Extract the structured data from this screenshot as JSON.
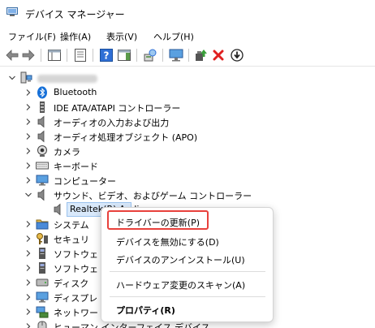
{
  "window": {
    "title": "デバイス マネージャー"
  },
  "menu": {
    "file": "ファイル(F)",
    "action": "操作(A)",
    "view": "表示(V)",
    "help": "ヘルプ(H)"
  },
  "tree": {
    "items": [
      {
        "label": "Bluetooth",
        "icon": "bluetooth-icon"
      },
      {
        "label": "IDE ATA/ATAPI コントローラー",
        "icon": "ide-controller-icon"
      },
      {
        "label": "オーディオの入力および出力",
        "icon": "speaker-icon"
      },
      {
        "label": "オーディオ処理オブジェクト (APO)",
        "icon": "speaker-icon"
      },
      {
        "label": "カメラ",
        "icon": "camera-icon"
      },
      {
        "label": "キーボード",
        "icon": "keyboard-icon"
      },
      {
        "label": "コンピューター",
        "icon": "monitor-icon"
      },
      {
        "label": "サウンド、ビデオ、およびゲーム コントローラー",
        "icon": "speaker-icon"
      },
      {
        "label": "Realtek(R) Audio",
        "icon": "speaker-icon"
      },
      {
        "label": "システム",
        "icon": "folder-icon"
      },
      {
        "label": "セキュリ",
        "icon": "security-key-icon"
      },
      {
        "label": "ソフトウェ",
        "icon": "software-device-icon"
      },
      {
        "label": "ソフトウェ",
        "icon": "software-component-icon"
      },
      {
        "label": "ディスク",
        "icon": "disk-icon"
      },
      {
        "label": "ディスプレ",
        "icon": "display-adapter-icon"
      },
      {
        "label": "ネットワー",
        "icon": "network-icon"
      },
      {
        "label": "ヒューマン インターフェイス デバイス",
        "icon": "hid-icon"
      }
    ]
  },
  "context_menu": {
    "update_driver": "ドライバーの更新(P)",
    "disable_device": "デバイスを無効にする(D)",
    "uninstall_device": "デバイスのアンインストール(U)",
    "scan_hardware": "ハードウェア変更のスキャン(A)",
    "properties": "プロパティ(R)"
  },
  "colors": {
    "highlight_border": "#e8413c",
    "toolbar_blue": "#2f6fd6",
    "remove_red": "#e02020",
    "bluetooth_blue": "#1670d8"
  }
}
